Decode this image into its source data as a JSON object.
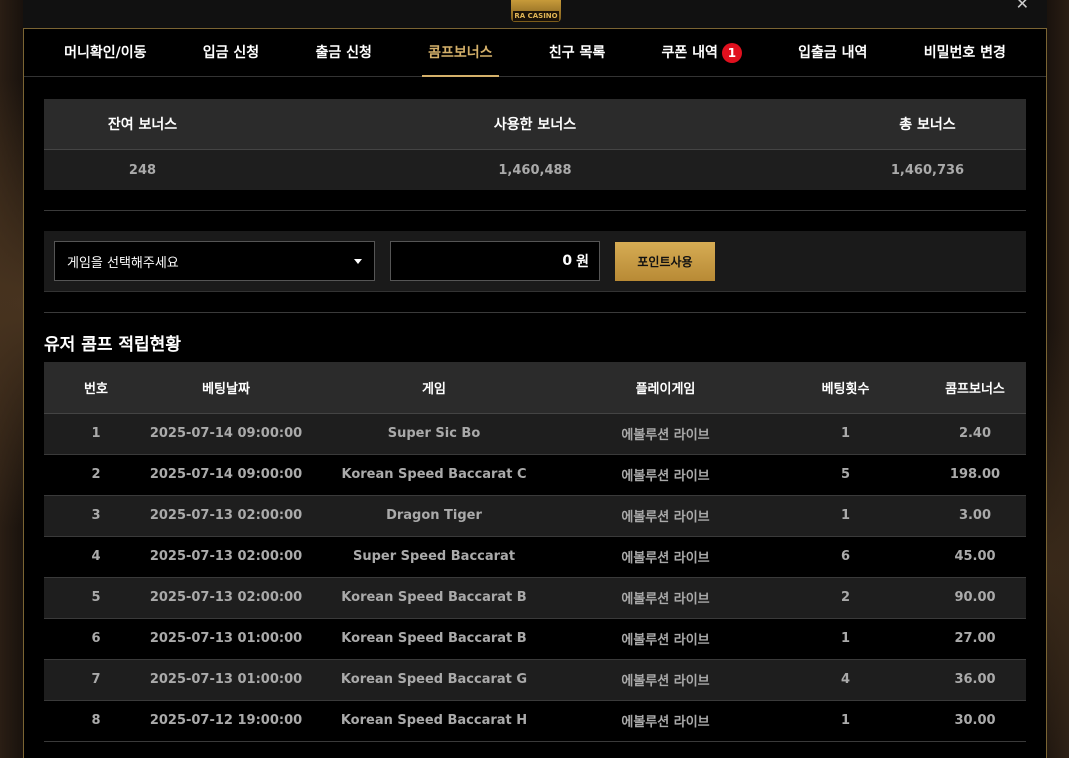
{
  "logo_text": "RA CASINO",
  "tabs": [
    {
      "label": "머니확인/이동"
    },
    {
      "label": "입금 신청"
    },
    {
      "label": "출금 신청"
    },
    {
      "label": "콤프보너스"
    },
    {
      "label": "친구 목록"
    },
    {
      "label": "쿠폰 내역",
      "badge": "1"
    },
    {
      "label": "입출금 내역"
    },
    {
      "label": "비밀번호 변경"
    }
  ],
  "summary": {
    "headers": [
      "잔여 보너스",
      "사용한 보너스",
      "총 보너스"
    ],
    "values": [
      "248",
      "1,460,488",
      "1,460,736"
    ]
  },
  "use_points": {
    "select_value": "게임을 선택해주세요",
    "amount": "0",
    "unit": "원",
    "button_label": "포인트사용"
  },
  "section_title": "유저 콤프 적립현황",
  "table": {
    "headers": [
      "번호",
      "베팅날짜",
      "게임",
      "플레이게임",
      "베팅횟수",
      "콤프보너스"
    ],
    "rows": [
      [
        "1",
        "2025-07-14 09:00:00",
        "Super Sic Bo",
        "에볼루션 라이브",
        "1",
        "2.40"
      ],
      [
        "2",
        "2025-07-14 09:00:00",
        "Korean Speed Baccarat C",
        "에볼루션 라이브",
        "5",
        "198.00"
      ],
      [
        "3",
        "2025-07-13 02:00:00",
        "Dragon Tiger",
        "에볼루션 라이브",
        "1",
        "3.00"
      ],
      [
        "4",
        "2025-07-13 02:00:00",
        "Super Speed Baccarat",
        "에볼루션 라이브",
        "6",
        "45.00"
      ],
      [
        "5",
        "2025-07-13 02:00:00",
        "Korean Speed Baccarat B",
        "에볼루션 라이브",
        "2",
        "90.00"
      ],
      [
        "6",
        "2025-07-13 01:00:00",
        "Korean Speed Baccarat B",
        "에볼루션 라이브",
        "1",
        "27.00"
      ],
      [
        "7",
        "2025-07-13 01:00:00",
        "Korean Speed Baccarat G",
        "에볼루션 라이브",
        "4",
        "36.00"
      ],
      [
        "8",
        "2025-07-12 19:00:00",
        "Korean Speed Baccarat H",
        "에볼루션 라이브",
        "1",
        "30.00"
      ]
    ]
  },
  "colors": {
    "accent_gold": "#d4b06a",
    "badge_red": "#e0101e"
  }
}
